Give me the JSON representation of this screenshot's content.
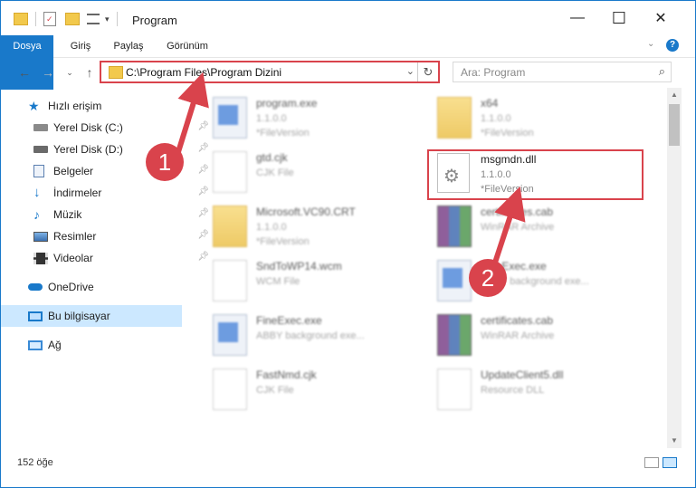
{
  "window": {
    "title": "Program",
    "controls": {
      "minimize": "—",
      "maximize": "☐",
      "close": "✕"
    }
  },
  "ribbon": {
    "tabs": [
      "Dosya",
      "Giriş",
      "Paylaş",
      "Görünüm"
    ],
    "accent": "#1979ca"
  },
  "address": {
    "path": "C:\\Program Files\\Program Dizini",
    "search_placeholder": "Ara: Program"
  },
  "nav": {
    "items": [
      {
        "label": "Hızlı erişim",
        "icon": "star-icon"
      },
      {
        "label": "Yerel Disk (C:)",
        "icon": "drive-icon",
        "pinned": true
      },
      {
        "label": "Yerel Disk (D:)",
        "icon": "drive-icon",
        "pinned": true
      },
      {
        "label": "Belgeler",
        "icon": "documents-icon",
        "pinned": true
      },
      {
        "label": "İndirmeler",
        "icon": "download-icon",
        "pinned": true
      },
      {
        "label": "Müzik",
        "icon": "music-icon",
        "pinned": true
      },
      {
        "label": "Resimler",
        "icon": "pictures-icon",
        "pinned": true
      },
      {
        "label": "Videolar",
        "icon": "video-icon",
        "pinned": true
      },
      {
        "label": "OneDrive",
        "icon": "cloud-icon"
      },
      {
        "label": "Bu bilgisayar",
        "icon": "computer-icon",
        "selected": true
      },
      {
        "label": "Ağ",
        "icon": "network-icon"
      }
    ]
  },
  "files": [
    {
      "name": "program.exe",
      "line2": "1.1.0.0",
      "line3": "*FileVersion",
      "kind": "exe",
      "blurred": true
    },
    {
      "name": "x64",
      "line2": "1.1.0.0",
      "line3": "*FileVersion",
      "kind": "folder",
      "blurred": true
    },
    {
      "name": "gtd.cjk",
      "line2": "CJK File",
      "line3": "",
      "kind": "doc",
      "blurred": true
    },
    {
      "name": "msgmdn.dll",
      "line2": "1.1.0.0",
      "line3": "*FileVersion",
      "kind": "dll",
      "blurred": false
    },
    {
      "name": "Microsoft.VC90.CRT",
      "line2": "1.1.0.0",
      "line3": "*FileVersion",
      "kind": "folder",
      "blurred": true
    },
    {
      "name": "certificates.cab",
      "line2": "WinRAR Archive",
      "line3": "",
      "kind": "rar",
      "blurred": true
    },
    {
      "name": "SndToWP14.wcm",
      "line2": "WCM File",
      "line3": "",
      "kind": "doc",
      "blurred": true
    },
    {
      "name": "FineExec.exe",
      "line2": "ABBY background exe...",
      "line3": "",
      "kind": "exe",
      "blurred": true
    },
    {
      "name": "FineExec.exe",
      "line2": "ABBY background exe...",
      "line3": "",
      "kind": "exe",
      "blurred": true
    },
    {
      "name": "certificates.cab",
      "line2": "WinRAR Archive",
      "line3": "",
      "kind": "rar",
      "blurred": true
    },
    {
      "name": "FastNmd.cjk",
      "line2": "CJK File",
      "line3": "",
      "kind": "doc",
      "blurred": true
    },
    {
      "name": "UpdateClient5.dll",
      "line2": "Resource DLL",
      "line3": "",
      "kind": "dll",
      "blurred": true
    }
  ],
  "status": {
    "count": "152 öğe"
  },
  "annotations": {
    "step1": "1",
    "step2": "2",
    "color": "#d9434c"
  }
}
